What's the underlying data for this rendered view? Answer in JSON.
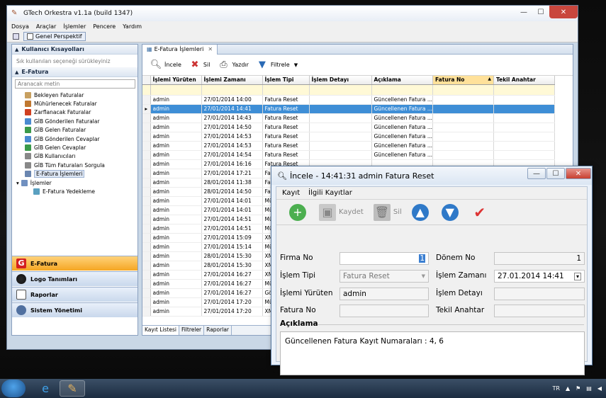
{
  "main_window": {
    "title": "GTech Orkestra v1.1a (build 1347)",
    "menu": [
      "Dosya",
      "Araçlar",
      "İşlemler",
      "Pencere",
      "Yardım"
    ],
    "perspective_button": "Genel Perspektif"
  },
  "left_panel": {
    "shortcuts_title": "Kullanıcı Kısayolları",
    "shortcuts_hint": "Sık kullanılan seçeneği sürükleyiniz",
    "efatura_title": "E-Fatura",
    "search_placeholder": "Aranacak metin",
    "tree": [
      {
        "label": "Bekleyen Faturalar",
        "color": "#c8a060"
      },
      {
        "label": "Mühürlenecek Faturalar",
        "color": "#c07830"
      },
      {
        "label": "Zarflanacak Faturalar",
        "color": "#d04020"
      },
      {
        "label": "GİB Gönderilen Faturalar",
        "color": "#4a8ad0"
      },
      {
        "label": "GİB Gelen Faturalar",
        "color": "#3a9a4a"
      },
      {
        "label": "GİB Gönderilen Cevaplar",
        "color": "#4a8ad0"
      },
      {
        "label": "GİB Gelen Cevaplar",
        "color": "#3a9a4a"
      },
      {
        "label": "GİB Kullanıcıları",
        "color": "#888888"
      },
      {
        "label": "GİB Tüm Faturaları Sorgula",
        "color": "#888888"
      },
      {
        "label": "E-Fatura İşlemleri",
        "color": "#6a86b0"
      },
      {
        "label": "İşlemler",
        "color": "#7090c0"
      },
      {
        "label": "E-Fatura Yedekleme",
        "color": "#5aa0c0"
      }
    ],
    "nav": [
      "E-Fatura",
      "Logo Tanımları",
      "Raporlar",
      "Sistem Yönetimi"
    ]
  },
  "center_panel": {
    "tab_label": "E-Fatura İşlemleri",
    "toolbar": {
      "view": "İncele",
      "delete": "Sil",
      "print": "Yazdır",
      "filter": "Filtrele"
    },
    "columns": [
      "İşlemi Yürüten",
      "İşlemi Zamanı",
      "İşlem Tipi",
      "İşlem Detayı",
      "Açıklama",
      "Fatura No",
      "Tekil Anahtar"
    ],
    "rows": [
      [
        "admin",
        "27/01/2014 14:00",
        "Fatura Reset",
        "",
        "Güncellenen Fatura ...",
        "",
        ""
      ],
      [
        "admin",
        "27/01/2014 14:41",
        "Fatura Reset",
        "",
        "Güncellenen Fatura ...",
        "",
        ""
      ],
      [
        "admin",
        "27/01/2014 14:43",
        "Fatura Reset",
        "",
        "Güncellenen Fatura ...",
        "",
        ""
      ],
      [
        "admin",
        "27/01/2014 14:50",
        "Fatura Reset",
        "",
        "Güncellenen Fatura ...",
        "",
        ""
      ],
      [
        "admin",
        "27/01/2014 14:53",
        "Fatura Reset",
        "",
        "Güncellenen Fatura ...",
        "",
        ""
      ],
      [
        "admin",
        "27/01/2014 14:53",
        "Fatura Reset",
        "",
        "Güncellenen Fatura ...",
        "",
        ""
      ],
      [
        "admin",
        "27/01/2014 14:54",
        "Fatura Reset",
        "",
        "Güncellenen Fatura ...",
        "",
        ""
      ],
      [
        "admin",
        "27/01/2014 16:16",
        "Fatura Reset",
        "",
        "",
        "",
        ""
      ],
      [
        "admin",
        "27/01/2014 17:21",
        "Fatura Reset",
        "",
        "",
        "",
        ""
      ],
      [
        "admin",
        "28/01/2014 11:38",
        "Fatura Reset",
        "",
        "",
        "",
        ""
      ],
      [
        "admin",
        "28/01/2014 14:50",
        "Fatura Reset",
        "",
        "",
        "",
        ""
      ],
      [
        "admin",
        "27/01/2014 14:01",
        "Mü",
        "",
        "",
        "",
        ""
      ],
      [
        "admin",
        "27/01/2014 14:01",
        "Mü",
        "",
        "",
        "",
        ""
      ],
      [
        "admin",
        "27/01/2014 14:51",
        "Mü",
        "",
        "",
        "",
        ""
      ],
      [
        "admin",
        "27/01/2014 14:51",
        "Mü",
        "",
        "",
        "",
        ""
      ],
      [
        "admin",
        "27/01/2014 15:09",
        "XM",
        "",
        "",
        "",
        ""
      ],
      [
        "admin",
        "27/01/2014 15:14",
        "Mü",
        "",
        "",
        "",
        ""
      ],
      [
        "admin",
        "28/01/2014 15:30",
        "XM",
        "",
        "",
        "",
        ""
      ],
      [
        "admin",
        "28/01/2014 15:30",
        "XM",
        "",
        "",
        "",
        ""
      ],
      [
        "admin",
        "27/01/2014 16:27",
        "XM",
        "",
        "",
        "",
        ""
      ],
      [
        "admin",
        "27/01/2014 16:27",
        "Mü",
        "",
        "",
        "",
        ""
      ],
      [
        "admin",
        "27/01/2014 16:27",
        "Gö",
        "",
        "",
        "",
        ""
      ],
      [
        "admin",
        "27/01/2014 17:20",
        "Mü",
        "",
        "",
        "",
        ""
      ],
      [
        "admin",
        "27/01/2014 17:20",
        "XM",
        "",
        "",
        "",
        ""
      ]
    ],
    "selected_row": 1,
    "bottom_tabs": [
      "Kayıt Listesi",
      "Filtreler",
      "Raporlar"
    ]
  },
  "dialog": {
    "title": "İncele - 14:41:31 admin Fatura Reset",
    "menu": [
      "Kayıt",
      "İlgili Kayıtlar"
    ],
    "toolbar": {
      "save": "Kaydet",
      "delete": "Sil"
    },
    "fields": {
      "firma_no_label": "Firma No",
      "firma_no": "1",
      "donem_no_label": "Dönem No",
      "donem_no": "1",
      "islem_tipi_label": "İşlem Tipi",
      "islem_tipi": "Fatura Reset",
      "islem_zamani_label": "İşlem Zamanı",
      "islem_zamani": "27.01.2014 14:41",
      "islemi_yuruten_label": "İşlemi Yürüten",
      "islemi_yuruten": "admin",
      "islem_detayi_label": "İşlem Detayı",
      "islem_detayi": "",
      "fatura_no_label": "Fatura No",
      "fatura_no": "",
      "tekil_anahtar_label": "Tekil Anahtar",
      "tekil_anahtar": ""
    },
    "aciklama_label": "Açıklama",
    "aciklama": "Güncellenen Fatura Kayıt Numaraları : 4, 6"
  },
  "taskbar": {
    "language": "TR"
  }
}
